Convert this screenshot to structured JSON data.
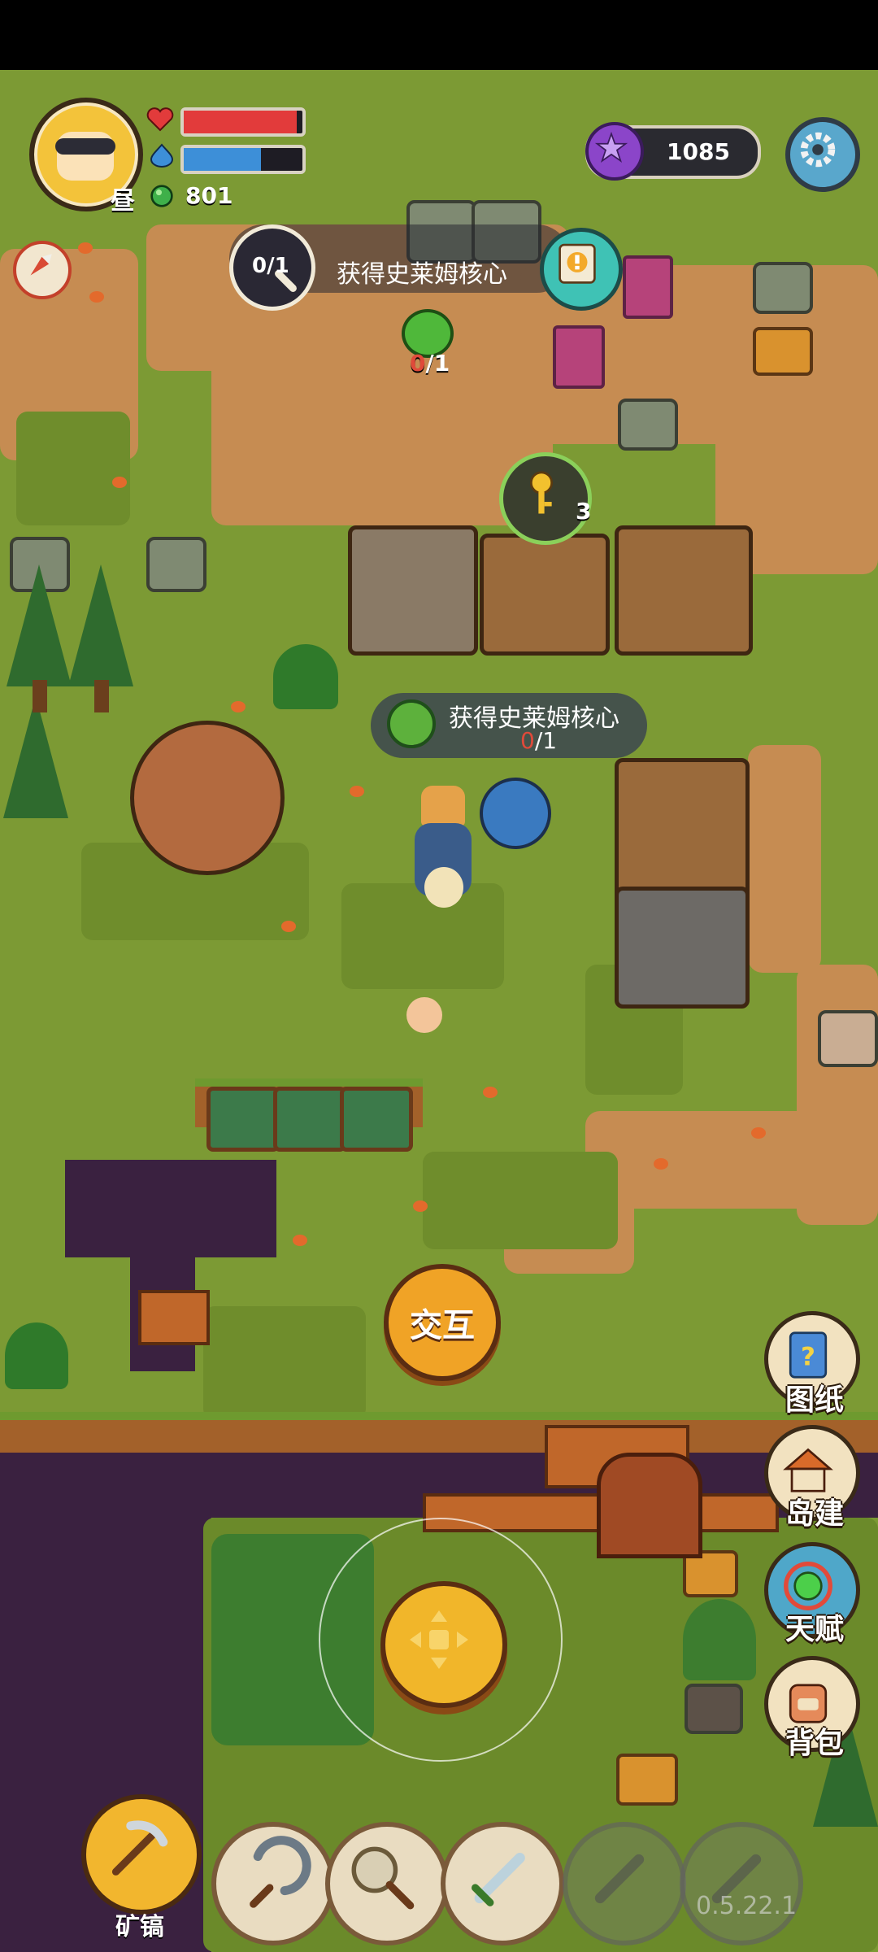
{
  "hud": {
    "time_of_day": "昼",
    "gem_count": "801",
    "hp_fraction": 0.95,
    "mp_fraction": 0.65,
    "currency_value": "1085"
  },
  "quest": {
    "count": "0/1",
    "text": "获得史莱姆核心"
  },
  "world": {
    "resource_need": "0",
    "resource_total": "/1",
    "key_count": "3",
    "tooltip": {
      "title": "获得史莱姆核心",
      "have": "0",
      "need": "/1"
    }
  },
  "actions": {
    "interact_label": "交互"
  },
  "side_menu": [
    {
      "label": "图纸"
    },
    {
      "label": "岛建"
    },
    {
      "label": "天赋"
    },
    {
      "label": "背包"
    }
  ],
  "toolbar": {
    "active_tool_label": "矿镐",
    "version": "0.5.22.1"
  },
  "colors": {
    "hp": "#e23b3b",
    "mp": "#3d8fd8",
    "gem": "#3fb04a",
    "accent": "#f0a326"
  }
}
